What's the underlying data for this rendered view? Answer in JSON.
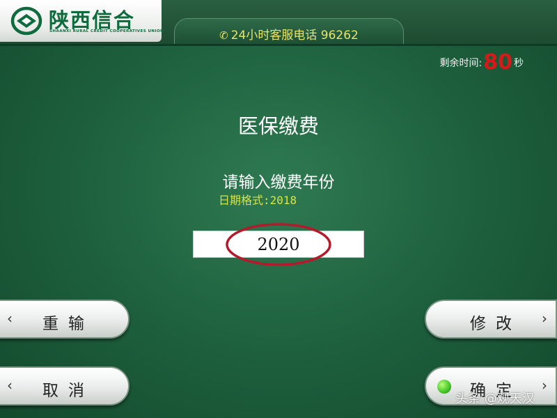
{
  "header": {
    "bank_name": "陕西信合",
    "bank_name_en": "SHAANXI RURAL CREDIT COOPERATIVES UNION",
    "phone_icon": "phone-icon",
    "hotline": "24小时客服电话 96262"
  },
  "timer": {
    "label": "剩余时间:",
    "value": "80",
    "unit": "秒"
  },
  "page": {
    "title": "医保缴费",
    "prompt": "请输入缴费年份",
    "hint": "日期格式:2018"
  },
  "input": {
    "value": "2020"
  },
  "buttons": {
    "reenter": "重输",
    "cancel": "取消",
    "modify": "修改",
    "confirm": "确定",
    "left_chevron": "‹",
    "right_chevron": "›"
  },
  "watermark": {
    "text": "头条 @观天汉"
  },
  "colors": {
    "background": "#1f6340",
    "accent": "#e7e46c",
    "timer_value": "#d91818",
    "highlight": "#b5192b"
  }
}
